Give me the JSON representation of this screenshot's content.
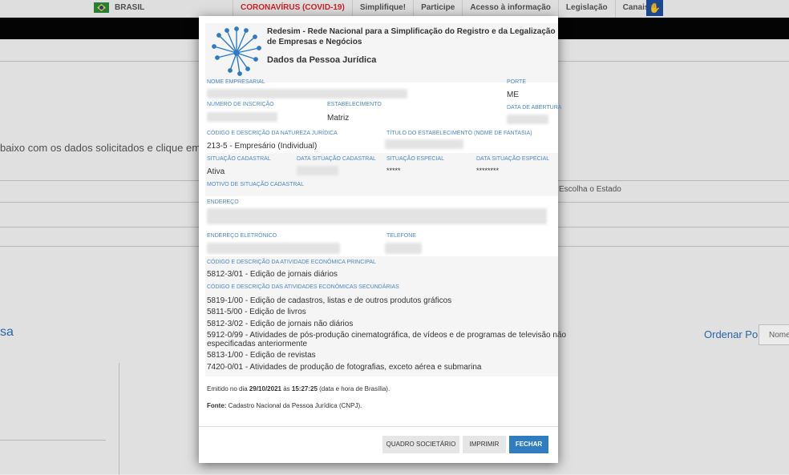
{
  "gov_bar": {
    "country": "BRASIL",
    "links": [
      "CORONAVÍRUS (COVID-19)",
      "Simplifique!",
      "Participe",
      "Acesso à informação",
      "Legislação",
      "Canais"
    ],
    "accent_covid": "#d9262c"
  },
  "background": {
    "instruction_text": "baixo com os dados solicitados e clique em \"Pe",
    "state_placeholder": "Escolha o Estado",
    "title_fragment": "sa",
    "order_label": "Ordenar Por",
    "order_select": "Nome"
  },
  "modal": {
    "title_line1": "Redesim - Rede Nacional para a Simplificação do Registro e da Legalização",
    "title_line2": "de Empresas e Negócios",
    "subtitle": "Dados da Pessoa Jurídica",
    "labels": {
      "nome_empresarial": "NOME EMPRESARIAL",
      "porte": "PORTE",
      "numero_inscricao": "NÚMERO DE INSCRIÇÃO",
      "estabelecimento": "ESTABELECIMENTO",
      "data_abertura": "DATA DE ABERTURA",
      "natureza_juridica": "CÓDIGO E DESCRIÇÃO DA NATUREZA JURÍDICA",
      "titulo_estabelecimento": "TÍTULO DO ESTABELECIMENTO (NOME DE FANTASIA)",
      "situacao_cadastral": "SITUAÇÃO CADASTRAL",
      "data_situacao_cadastral": "DATA SITUAÇÃO CADASTRAL",
      "situacao_especial": "SITUAÇÃO ESPECIAL",
      "data_situacao_especial": "DATA SITUAÇÃO ESPECIAL",
      "motivo_situacao": "MOTIVO DE SITUAÇÃO CADASTRAL",
      "endereco": "ENDEREÇO",
      "endereco_eletronico": "ENDEREÇO ELETRÔNICO",
      "telefone": "TELEFONE",
      "atividade_principal": "CÓDIGO E DESCRIÇÃO DA ATIVIDADE ECONÔMICA PRINCIPAL",
      "atividades_secundarias": "CÓDIGO E DESCRIÇÃO DAS ATIVIDADES ECONÔMICAS SECUNDÁRIAS"
    },
    "values": {
      "porte": "ME",
      "estabelecimento": "Matriz",
      "natureza_juridica": "213-5 - Empresário (Individual)",
      "situacao_cadastral": "Ativa",
      "situacao_especial": "*****",
      "data_situacao_especial": "********",
      "atividade_principal": "5812-3/01 - Edição de jornais diários"
    },
    "atividades_secundarias": [
      "5819-1/00 - Edição de cadastros, listas e de outros produtos gráficos",
      "5811-5/00 - Edição de livros",
      "5812-3/02 - Edição de jornais não diários",
      "5912-0/99 - Atividades de pós-produção cinematográfica, de vídeos e de programas de televisão não",
      "especificadas anteriormente",
      "5813-1/00 - Edição de revistas",
      "7420-0/01 - Atividades de produção de fotografias, exceto aérea e submarina"
    ],
    "footer": {
      "emitido_prefix": "Emitido no dia ",
      "emitido_date": "29/10/2021",
      "emitido_mid": " às ",
      "emitido_time": "15:27:25",
      "emitido_suffix": " (data e hora de Brasília).",
      "fonte_label": "Fonte:",
      "fonte_text": " Cadastro Nacional da Pessoa Jurídica (CNPJ)."
    },
    "buttons": {
      "quadro": "QUADRO SOCIETÁRIO",
      "imprimir": "IMPRIMIR",
      "fechar": "FECHAR"
    },
    "accent_label": "#4d86c5",
    "accent_button": "#2f7cc1"
  }
}
